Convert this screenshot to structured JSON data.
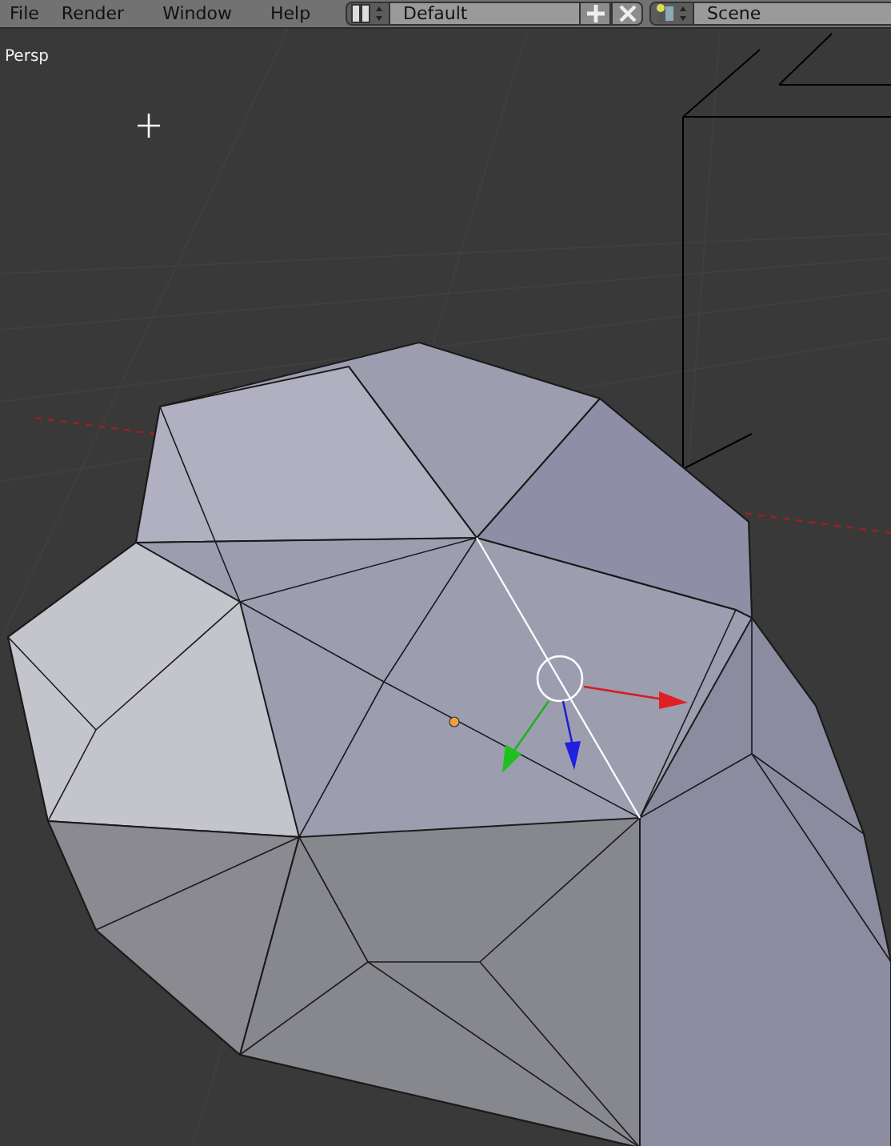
{
  "menu": [
    "File",
    "Render",
    "Window",
    "Help"
  ],
  "layout": {
    "value": "Default"
  },
  "scene": {
    "value": "Scene"
  },
  "viewport": {
    "label": "Persp"
  }
}
